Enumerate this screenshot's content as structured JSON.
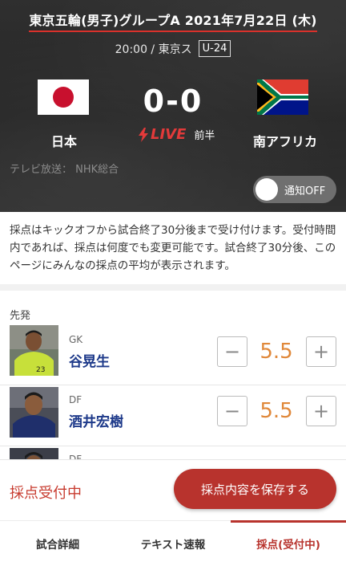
{
  "match": {
    "title": "東京五輪(男子)グループA 2021年7月22日 (木)",
    "time_venue": "20:00 / 東京ス",
    "category_badge": "U-24",
    "home_team": "日本",
    "away_team": "南アフリカ",
    "score": "0-0",
    "live_label": "LIVE",
    "period": "前半",
    "broadcast": "テレビ放送： NHK総合",
    "notify_label": "通知OFF",
    "notify_on": false
  },
  "notice": "採点はキックオフから試合終了30分後まで受け付けます。受付時間内であれば、採点は何度でも変更可能です。試合終了30分後、このページにみんなの採点の平均が表示されます。",
  "lineup": {
    "section_label": "先発",
    "players": [
      {
        "position": "GK",
        "name": "谷晃生",
        "rating": "5.5",
        "shirt_number": "23"
      },
      {
        "position": "DF",
        "name": "酒井宏樹",
        "rating": "5.5"
      },
      {
        "position": "DF"
      }
    ]
  },
  "bottom": {
    "status": "採点受付中",
    "save_button": "採点内容を保存する"
  },
  "tabs": [
    {
      "label": "試合詳細",
      "active": false
    },
    {
      "label": "テキスト速報",
      "active": false
    },
    {
      "label": "採点(受付中)",
      "active": true
    }
  ],
  "colors": {
    "accent": "#b8332d",
    "live": "#e23a3a",
    "rating": "#e0883a",
    "player_name": "#1e3a8a"
  }
}
